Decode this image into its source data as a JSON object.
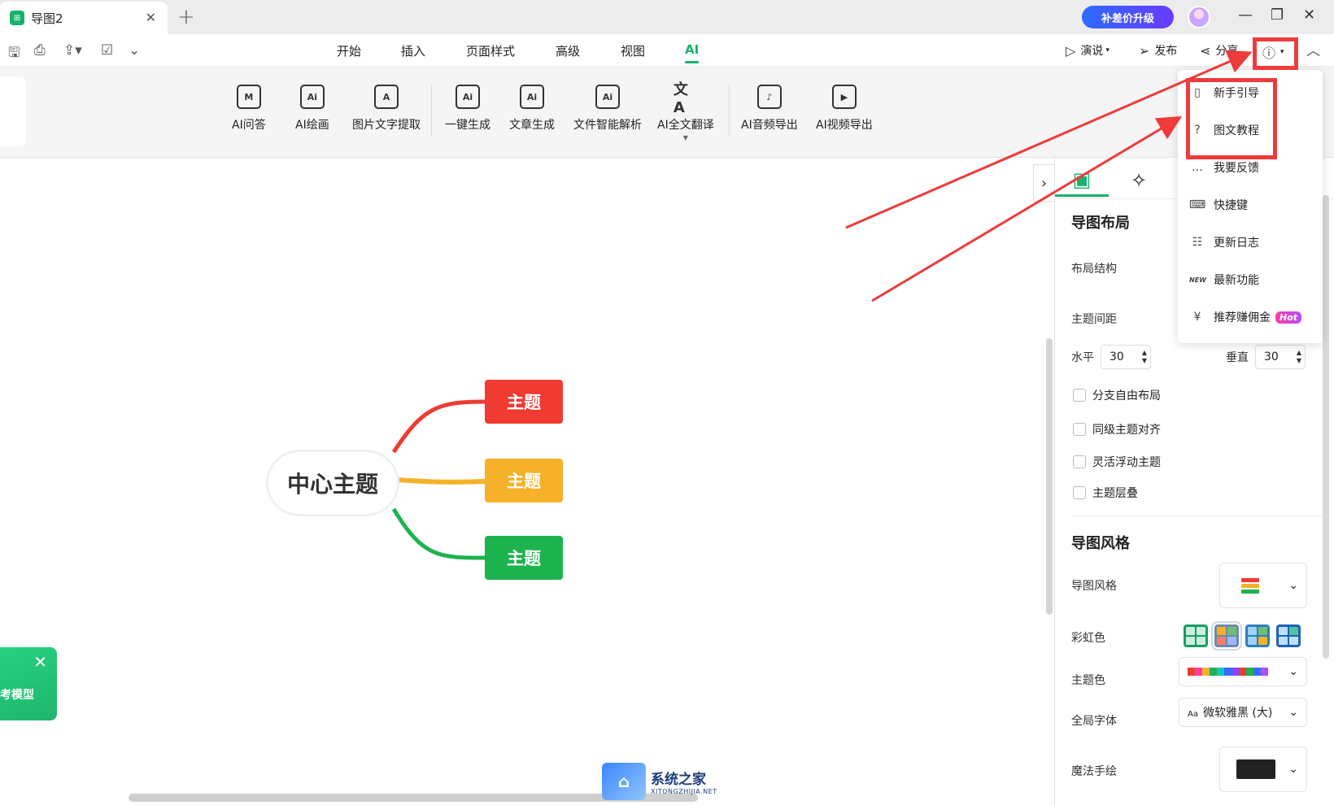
{
  "tab": {
    "title": "导图2",
    "logo_icon": "mindmap-app-icon"
  },
  "upgrade": {
    "label": "补差价升级"
  },
  "menu": {
    "tabs": [
      "开始",
      "插入",
      "页面样式",
      "高级",
      "视图",
      "AI"
    ],
    "active": "AI"
  },
  "actions": {
    "present": "演说",
    "publish": "发布",
    "share": "分享"
  },
  "tools": [
    "AI问答",
    "AI绘画",
    "图片文字提取",
    "一键生成",
    "文章生成",
    "文件智能解析",
    "AI全文翻译",
    "AI音频导出",
    "AI视频导出"
  ],
  "mindmap": {
    "central": "中心主题",
    "topics": [
      {
        "label": "主题",
        "color": "#ef3b32"
      },
      {
        "label": "主题",
        "color": "#f6b12a"
      },
      {
        "label": "主题",
        "color": "#1db34e"
      }
    ]
  },
  "promo": {
    "text": "思考模型"
  },
  "panel": {
    "layout_title": "导图布局",
    "structure_label": "布局结构",
    "spacing_label": "主题间距",
    "h_label": "水平",
    "h_value": "30",
    "v_label": "垂直",
    "v_value": "30",
    "checks": [
      "分支自由布局",
      "同级主题对齐",
      "灵活浮动主题",
      "主题层叠"
    ],
    "style_title": "导图风格",
    "style_label": "导图风格",
    "rainbow_label": "彩虹色",
    "theme_color_label": "主题色",
    "font_label": "全局字体",
    "font_value": "微软雅黑 (大)",
    "font_prefix": "Aa",
    "hand_label": "魔法手绘"
  },
  "help_menu": {
    "items": [
      {
        "label": "新手引导",
        "icon": "book-icon"
      },
      {
        "label": "图文教程",
        "icon": "question-icon"
      },
      {
        "label": "我要反馈",
        "icon": "feedback-icon"
      },
      {
        "label": "快捷键",
        "icon": "keyboard-icon"
      },
      {
        "label": "更新日志",
        "icon": "log-icon"
      },
      {
        "label": "最新功能",
        "icon": "new-icon"
      },
      {
        "label": "推荐赚佣金",
        "icon": "yen-icon"
      }
    ],
    "hot_badge": "Hot",
    "new_badge": "NEW"
  },
  "watermark": {
    "cn": "系统之家",
    "en": "XITONGZHIJIA.NET"
  },
  "colors": {
    "accent": "#17b26a",
    "highlight": "#ee3b3b"
  }
}
